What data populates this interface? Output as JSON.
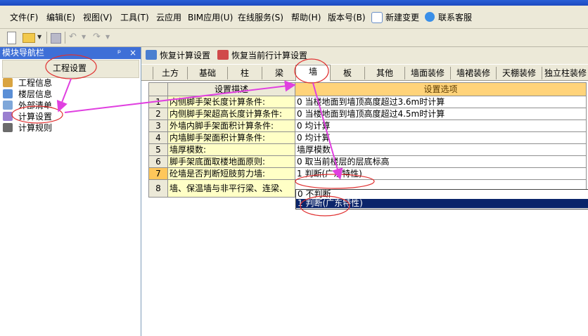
{
  "menu": {
    "items": [
      "文件(F)",
      "编辑(E)",
      "视图(V)",
      "工具(T)",
      "云应用",
      "BIM应用(U)",
      "在线服务(S)",
      "帮助(H)",
      "版本号(B)"
    ],
    "new_change": "新建变更",
    "contact": "联系客服"
  },
  "nav": {
    "title": "模块导航栏",
    "pin": "ᵖ",
    "close": "×",
    "button_label": "工程设置",
    "items": [
      "工程信息",
      "楼层信息",
      "外部清单",
      "计算设置",
      "计算规则"
    ]
  },
  "actions": {
    "restore_calc": "恢复计算设置",
    "restore_current": "恢复当前行计算设置"
  },
  "tabs": [
    "土方",
    "基础",
    "柱",
    "梁",
    "墙",
    "板",
    "其他",
    "墙面装修",
    "墙裙装修",
    "天棚装修",
    "独立柱装修"
  ],
  "active_tab": "墙",
  "grid": {
    "header_desc": "设置描述",
    "header_opt": "设置选项",
    "rows": [
      {
        "n": "1",
        "desc": "内侧脚手架长度计算条件:",
        "opt": "0 当楼地面到墙顶高度超过3.6m时计算"
      },
      {
        "n": "2",
        "desc": "内侧脚手架超高长度计算条件:",
        "opt": "0 当楼地面到墙顶高度超过4.5m时计算"
      },
      {
        "n": "3",
        "desc": "外墙内脚手架面积计算条件:",
        "opt": "0 均计算"
      },
      {
        "n": "4",
        "desc": "内墙脚手架面积计算条件:",
        "opt": "0 均计算"
      },
      {
        "n": "5",
        "desc": "墙厚模数:",
        "opt": "墙厚模数"
      },
      {
        "n": "6",
        "desc": "脚手架底面取楼地面原则:",
        "opt": "0 取当前楼层的层底标高"
      },
      {
        "n": "7",
        "desc": "砼墙是否判断短肢剪力墙:",
        "opt": "1 判断(广东特性)"
      },
      {
        "n": "8",
        "desc": "墙、保温墙与非平行梁、连梁、",
        "opt": ""
      }
    ]
  },
  "dropdown": {
    "options": [
      "0 不判断",
      "1 判断(广东特性)"
    ],
    "selected": "1 判断(广东特性)"
  },
  "colors": {
    "annotation": "#e040e0",
    "circle": "#e03030",
    "desc_bg": "#ffffc6",
    "header_opt_bg": "#ffd37a",
    "selection": "#0a246a",
    "nav_header": "#3e6fd7"
  }
}
